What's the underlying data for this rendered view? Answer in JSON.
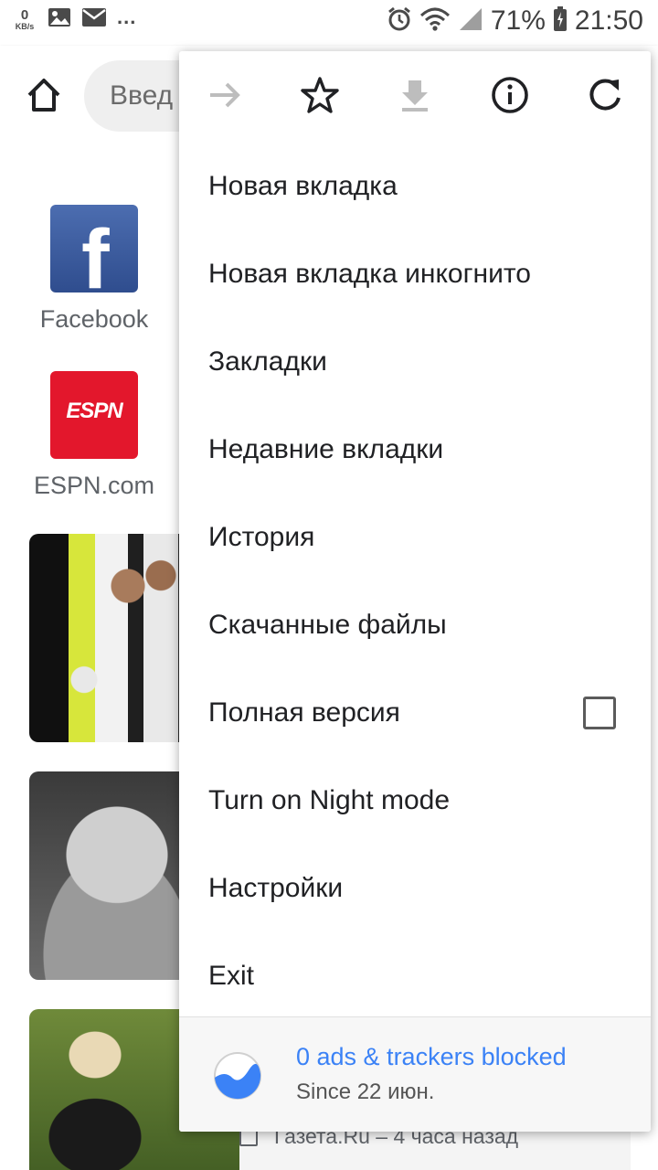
{
  "status_bar": {
    "net_speed_value": "0",
    "net_speed_unit": "KB/s",
    "more_indicator": "...",
    "battery_percent": "71%",
    "time": "21:50",
    "icons": [
      "image-icon",
      "mail-icon",
      "alarm-icon",
      "wifi-icon",
      "signal-icon",
      "battery-icon"
    ]
  },
  "toolbar": {
    "home_icon": "home-icon",
    "omnibox_text": "Введ"
  },
  "speed_dial": [
    {
      "label": "Facebook",
      "icon": "facebook-logo",
      "icon_text": "f",
      "color": "#3b5998"
    },
    {
      "label": "ESPN.com",
      "icon": "espn-logo",
      "icon_text": "ESPN",
      "color": "#e3172c"
    }
  ],
  "feed_footer_text": "Газета.Ru – 4 часа назад",
  "menu": {
    "icons": [
      "forward-icon",
      "star-icon",
      "download-icon",
      "info-icon",
      "reload-icon"
    ],
    "items": [
      {
        "label": "Новая вкладка"
      },
      {
        "label": "Новая вкладка инкогнито"
      },
      {
        "label": "Закладки"
      },
      {
        "label": "Недавние вкладки"
      },
      {
        "label": "История"
      },
      {
        "label": "Скачанные файлы"
      },
      {
        "label": "Полная версия",
        "checkbox": true,
        "checked": false
      },
      {
        "label": "Turn on Night mode"
      },
      {
        "label": "Настройки"
      },
      {
        "label": "Exit"
      }
    ],
    "footer": {
      "title": "0 ads & trackers blocked",
      "subtitle": "Since 22 июн."
    }
  },
  "colors": {
    "accent_blue": "#3b82f6",
    "menu_bg": "#ffffff",
    "text_primary": "#202124"
  }
}
